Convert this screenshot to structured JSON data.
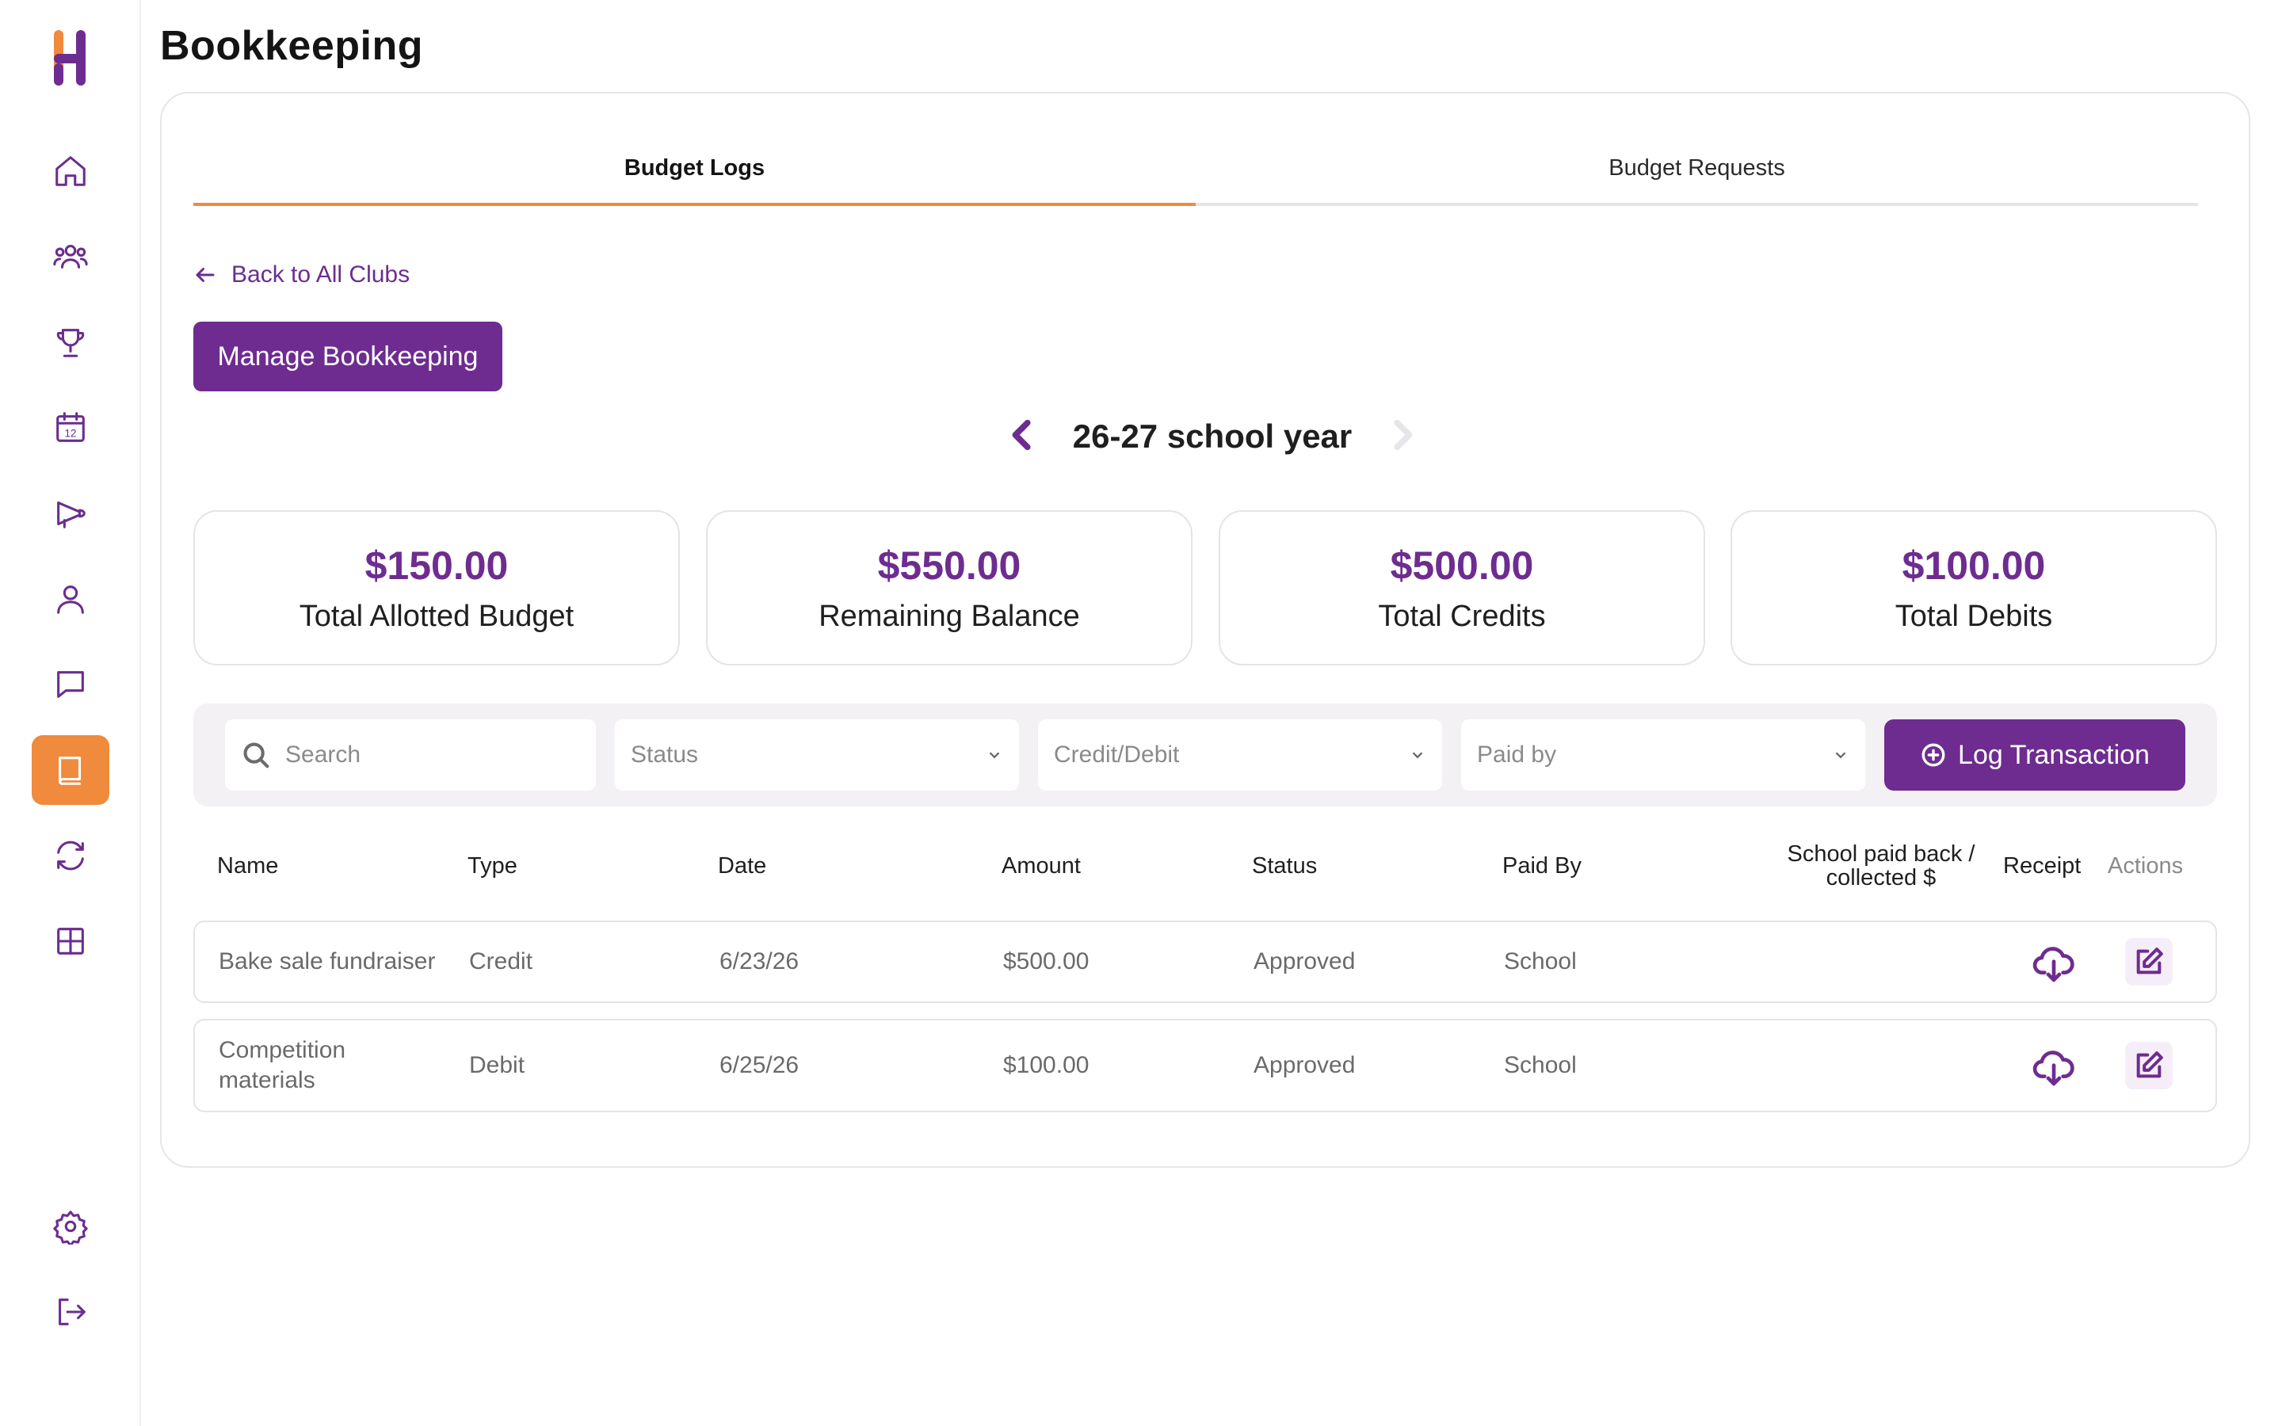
{
  "page": {
    "title": "Bookkeeping"
  },
  "sidebar": {
    "logo": "H",
    "items": [
      {
        "icon": "home-icon",
        "active": false
      },
      {
        "icon": "members-icon",
        "active": false
      },
      {
        "icon": "trophy-icon",
        "active": false
      },
      {
        "icon": "calendar-icon",
        "calendar_day": "12",
        "active": false
      },
      {
        "icon": "megaphone-icon",
        "active": false
      },
      {
        "icon": "user-icon",
        "active": false
      },
      {
        "icon": "chat-icon",
        "active": false
      },
      {
        "icon": "book-icon",
        "active": true
      },
      {
        "icon": "sync-icon",
        "active": false
      },
      {
        "icon": "grid-icon",
        "active": false
      },
      {
        "icon": "settings-icon",
        "active": false
      },
      {
        "icon": "logout-icon",
        "active": false
      }
    ]
  },
  "tabs": [
    {
      "label": "Budget Logs",
      "active": true
    },
    {
      "label": "Budget Requests",
      "active": false
    }
  ],
  "back_link": "Back to All Clubs",
  "manage_button": "Manage Bookkeeping",
  "year": {
    "label": "26-27 school year"
  },
  "stats": [
    {
      "value": "$150.00",
      "label": "Total Allotted Budget"
    },
    {
      "value": "$550.00",
      "label": "Remaining Balance"
    },
    {
      "value": "$500.00",
      "label": "Total Credits"
    },
    {
      "value": "$100.00",
      "label": "Total Debits"
    }
  ],
  "filters": {
    "search_placeholder": "Search",
    "status": "Status",
    "credit_debit": "Credit/Debit",
    "paid_by": "Paid by",
    "log_button": "Log Transaction"
  },
  "table": {
    "headers": {
      "name": "Name",
      "type": "Type",
      "date": "Date",
      "amount": "Amount",
      "status": "Status",
      "paid_by": "Paid By",
      "school_paid_line1": "School paid back /",
      "school_paid_line2": "collected $",
      "receipt": "Receipt",
      "actions": "Actions"
    },
    "rows": [
      {
        "name": "Bake sale fundraiser",
        "type": "Credit",
        "date": "6/23/26",
        "amount": "$500.00",
        "status": "Approved",
        "paid_by": "School",
        "school_paid": ""
      },
      {
        "name": "Competition materials",
        "type": "Debit",
        "date": "6/25/26",
        "amount": "$100.00",
        "status": "Approved",
        "paid_by": "School",
        "school_paid": ""
      }
    ]
  },
  "colors": {
    "accent": "#6e2c90",
    "active_nav": "#f08a3c",
    "tab_underline": "#f08a3c"
  }
}
